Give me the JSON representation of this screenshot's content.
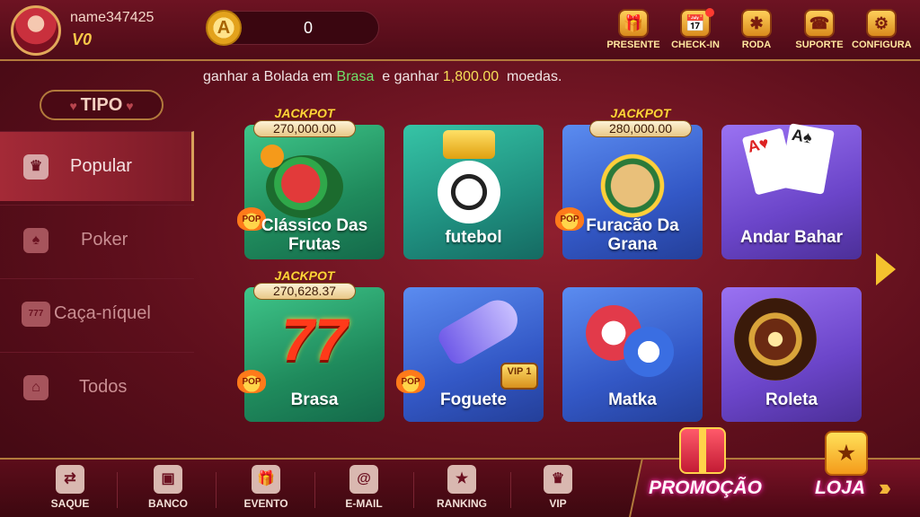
{
  "user": {
    "name": "name347425",
    "vip_level": "V0"
  },
  "balance": {
    "value": "0"
  },
  "top_actions": [
    {
      "label": "PRESENTE",
      "icon": "gift-icon",
      "glyph": "🎁"
    },
    {
      "label": "CHECK-IN",
      "icon": "calendar-icon",
      "glyph": "📅"
    },
    {
      "label": "RODA",
      "icon": "wheel-icon",
      "glyph": "✱"
    },
    {
      "label": "SUPORTE",
      "icon": "support-icon",
      "glyph": "☎"
    },
    {
      "label": "CONFIGURA",
      "icon": "gear-icon",
      "glyph": "⚙"
    }
  ],
  "marquee": {
    "part1": "ganhar a Bolada em ",
    "game": "Brasa",
    "part2": "  e ganhar ",
    "amount": "1,800.00",
    "part3": "  moedas."
  },
  "sidebar": {
    "title": "TIPO",
    "items": [
      {
        "label": "Popular",
        "icon": "crown-icon",
        "glyph": "♛"
      },
      {
        "label": "Poker",
        "icon": "cards-icon",
        "glyph": "♠"
      },
      {
        "label": "Caça-níquel",
        "icon": "slot-machine-icon",
        "glyph": "777"
      },
      {
        "label": "Todos",
        "icon": "home-icon",
        "glyph": "⌂"
      }
    ]
  },
  "games": [
    {
      "title": "Clássico Das Frutas",
      "jackpot_label": "JACKPOT",
      "jackpot": "270,000.00",
      "pop": "POP"
    },
    {
      "title": "futebol"
    },
    {
      "title": "Furacão Da Grana",
      "jackpot_label": "JACKPOT",
      "jackpot": "280,000.00",
      "pop": "POP"
    },
    {
      "title": "Andar Bahar"
    },
    {
      "title": "Brasa",
      "jackpot_label": "JACKPOT",
      "jackpot": "270,628.37",
      "pop": "POP"
    },
    {
      "title": "Foguete",
      "pop": "POP",
      "vip_badge": "VIP 1"
    },
    {
      "title": "Matka"
    },
    {
      "title": "Roleta"
    }
  ],
  "bottom_nav": [
    {
      "label": "SAQUE",
      "icon": "withdraw-icon",
      "glyph": "⇄"
    },
    {
      "label": "BANCO",
      "icon": "safe-icon",
      "glyph": "▣"
    },
    {
      "label": "EVENTO",
      "icon": "event-gift-icon",
      "glyph": "🎁"
    },
    {
      "label": "E-MAIL",
      "icon": "mail-icon",
      "glyph": "@"
    },
    {
      "label": "RANKING",
      "icon": "trophy-icon",
      "glyph": "★"
    },
    {
      "label": "VIP",
      "icon": "vip-crown-icon",
      "glyph": "♛"
    }
  ],
  "promo": {
    "label": "PROMOÇÃO"
  },
  "shop": {
    "label": "LOJA",
    "glyph": "★"
  },
  "colors": {
    "accent_gold": "#f5c22e",
    "highlight_green": "#6fe06a",
    "highlight_yellow": "#f7df58",
    "background": "#6d1322"
  }
}
